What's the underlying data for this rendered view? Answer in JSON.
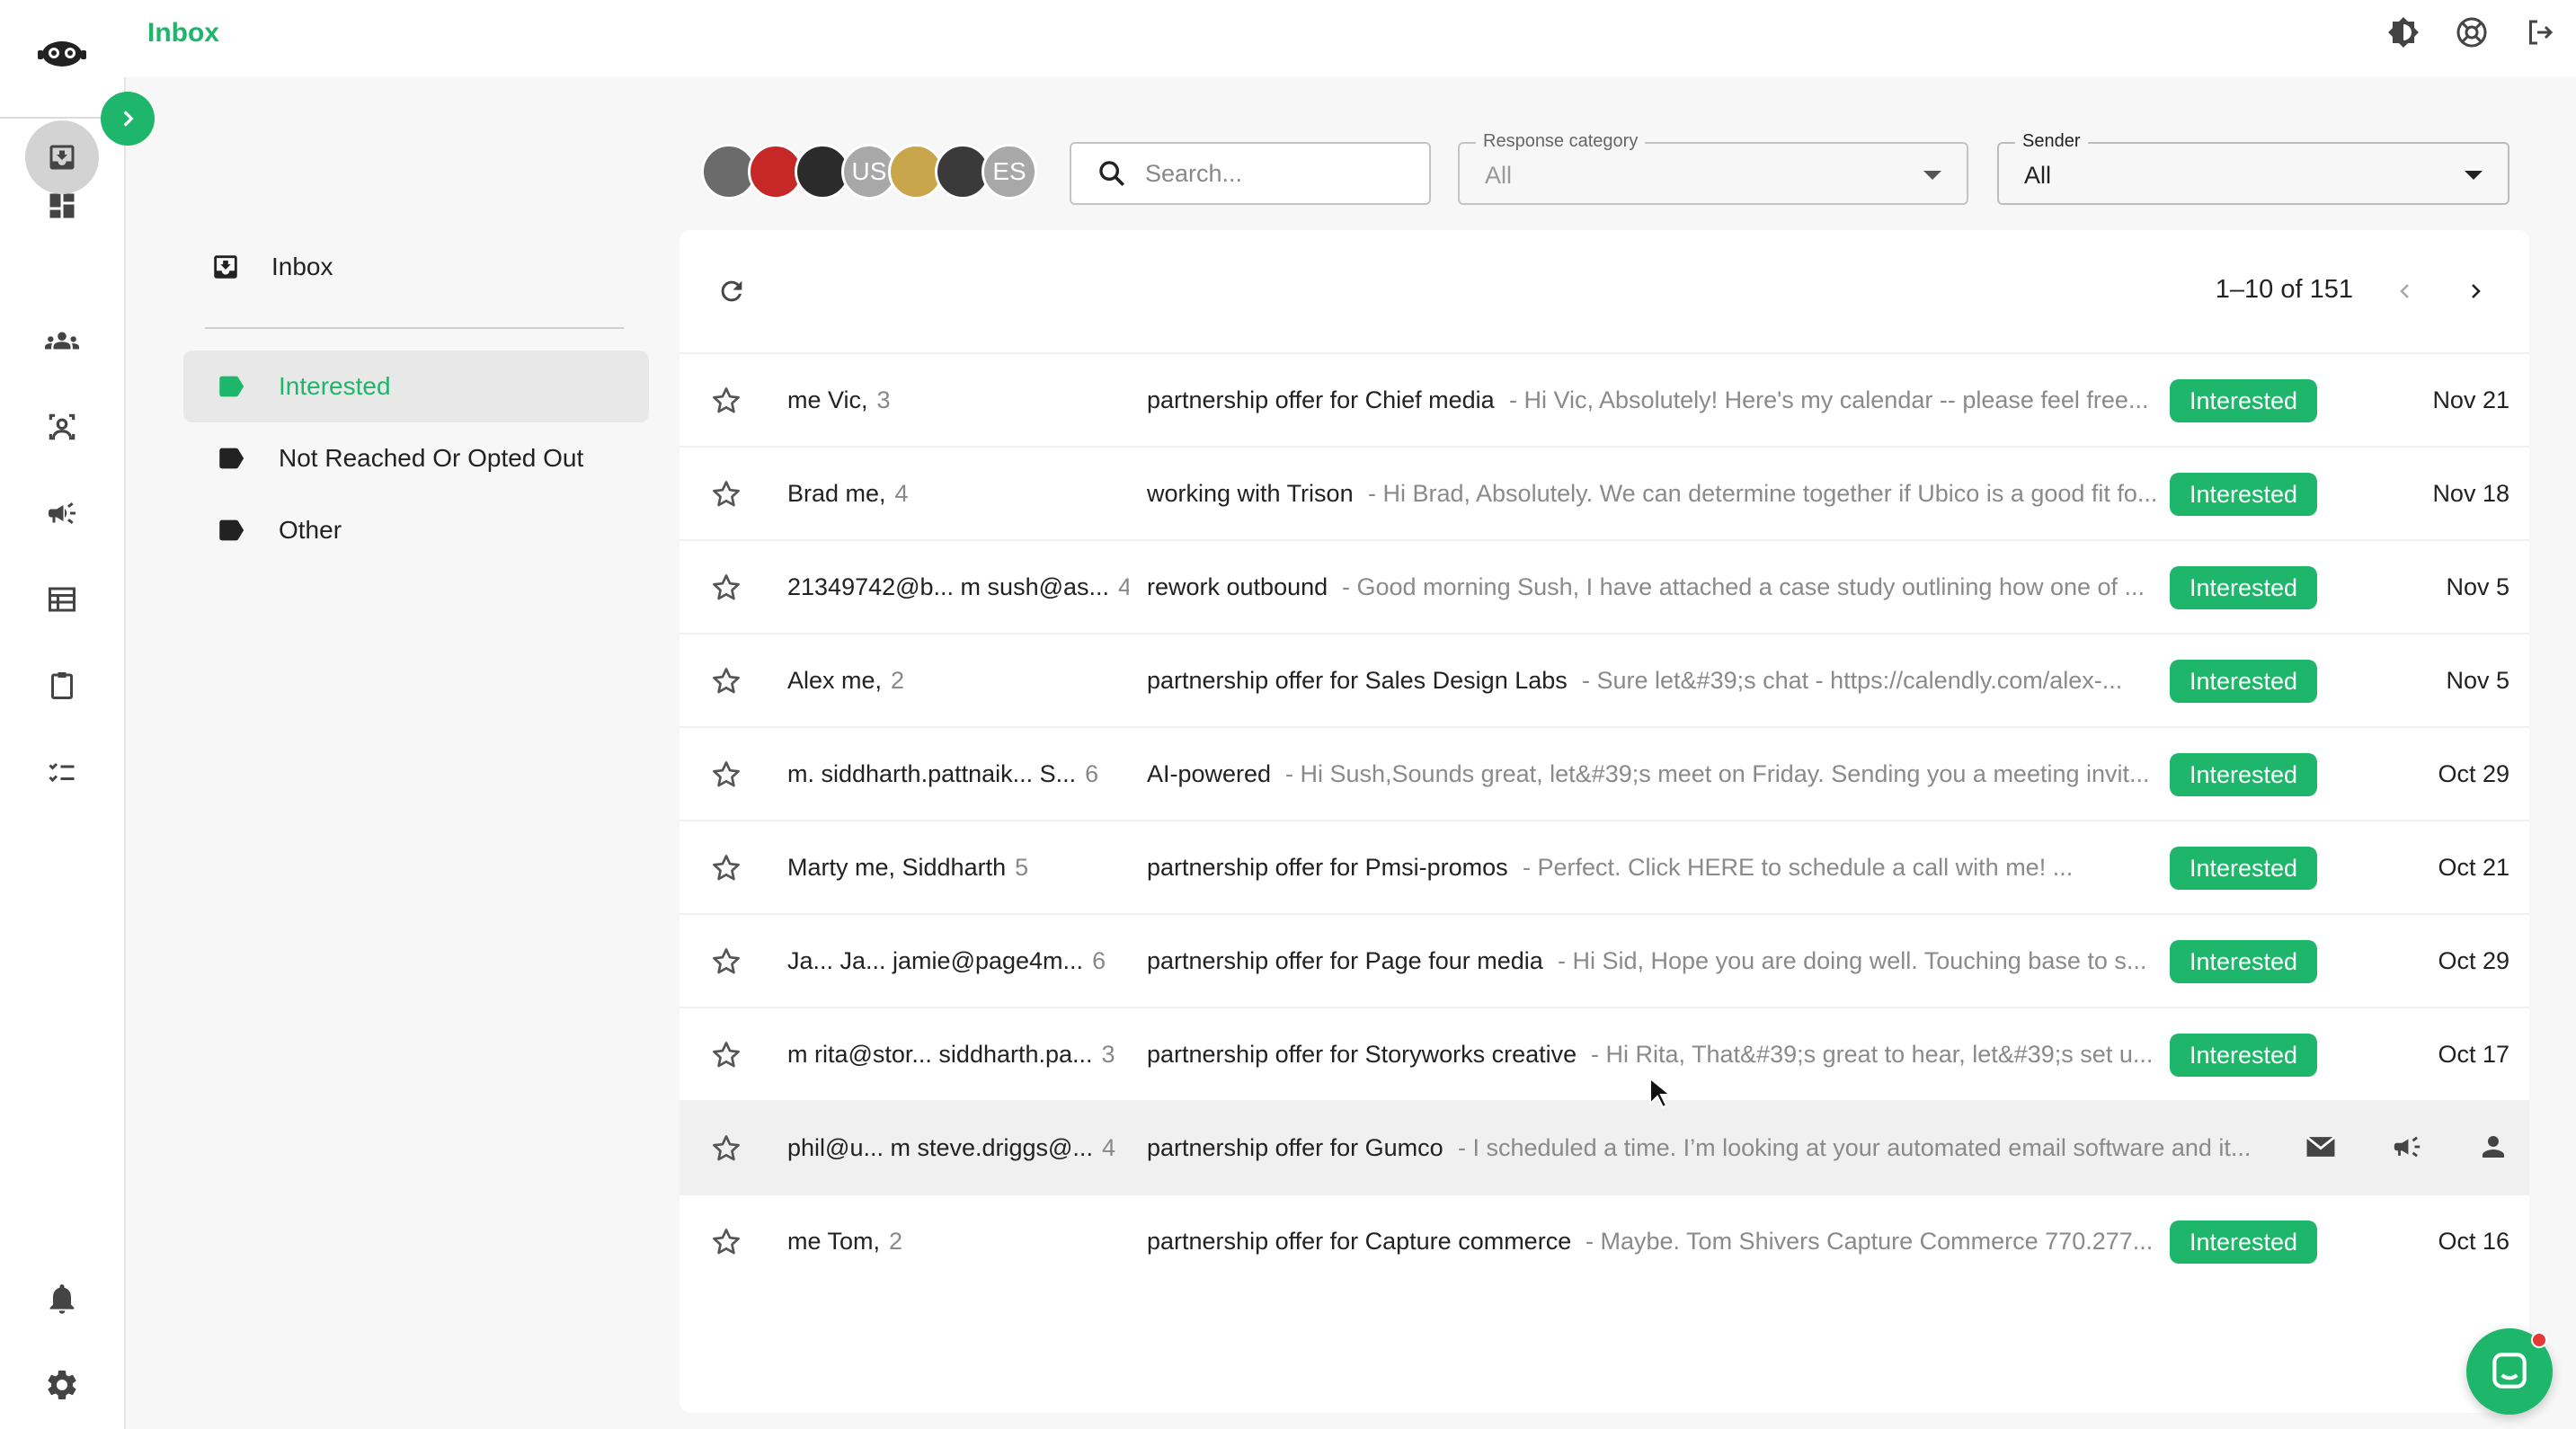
{
  "app": {
    "title": "Inbox",
    "brand_color": "#1db66a"
  },
  "topbar": {
    "icons": [
      "theme-toggle-icon",
      "support-icon",
      "logout-icon"
    ]
  },
  "rail": {
    "items": [
      {
        "name": "dashboard-icon"
      },
      {
        "name": "inbox-icon",
        "active": true
      },
      {
        "name": "team-icon"
      },
      {
        "name": "contacts-icon"
      },
      {
        "name": "campaigns-icon"
      },
      {
        "name": "table-icon"
      },
      {
        "name": "clipboard-icon"
      },
      {
        "name": "tasks-icon"
      }
    ],
    "bottom": [
      "bell-icon",
      "settings-icon"
    ]
  },
  "folders": {
    "inbox_label": "Inbox",
    "items": [
      {
        "label": "Interested",
        "active": true
      },
      {
        "label": "Not Reached Or Opted Out",
        "active": false
      },
      {
        "label": "Other",
        "active": false
      }
    ]
  },
  "filters": {
    "avatars": [
      {
        "initials": "",
        "color": "#6b6b6b"
      },
      {
        "initials": "",
        "color": "#c62828"
      },
      {
        "initials": "",
        "color": "#2b2b2b"
      },
      {
        "initials": "US",
        "color": "#9e9e9e"
      },
      {
        "initials": "",
        "color": "#c9a54c"
      },
      {
        "initials": "",
        "color": "#3a3a3a"
      },
      {
        "initials": "ES",
        "color": "#9e9e9e"
      }
    ],
    "search_placeholder": "Search...",
    "response_category_label": "Response category",
    "response_category_value": "All",
    "sender_label": "Sender",
    "sender_value": "All"
  },
  "list": {
    "pager": "1–10 of 151",
    "rows": [
      {
        "sender": "me Vic,",
        "count": "3",
        "subject": "partnership offer for Chief media",
        "snippet": "Hi Vic, Absolutely! Here's my calendar -- please feel free...",
        "badge": "Interested",
        "date": "Nov 21"
      },
      {
        "sender": "Brad me,",
        "count": "4",
        "subject": "working with Trison",
        "snippet": "Hi Brad, Absolutely. We can determine together if Ubico is a good fit fo...",
        "badge": "Interested",
        "date": "Nov 18"
      },
      {
        "sender": "21349742@b...   m sush@as...",
        "count": "4",
        "subject": "rework outbound",
        "snippet": "Good morning Sush, I have attached a case study outlining how one of ...",
        "badge": "Interested",
        "date": "Nov 5"
      },
      {
        "sender": "Alex me,",
        "count": "2",
        "subject": "partnership offer for Sales Design Labs",
        "snippet": "Sure let&#39;s chat - https://calendly.com/alex-...",
        "badge": "Interested",
        "date": "Nov 5"
      },
      {
        "sender": "m. siddharth.pattnaik...   S...",
        "count": "6",
        "subject": "AI-powered",
        "snippet": "Hi Sush,Sounds great, let&#39;s meet on Friday. Sending you a meeting invit...",
        "badge": "Interested",
        "date": "Oct 29"
      },
      {
        "sender": "Marty me, Siddharth",
        "count": "5",
        "subject": "partnership offer for Pmsi-promos",
        "snippet": "Perfect.   Click HERE to schedule a call with me!            ...",
        "badge": "Interested",
        "date": "Oct 21"
      },
      {
        "sender": "Ja...   Ja...   jamie@page4m...",
        "count": "6",
        "subject": "partnership offer for Page four media",
        "snippet": "Hi Sid, Hope you are doing well. Touching base to s...",
        "badge": "Interested",
        "date": "Oct 29"
      },
      {
        "sender": "m rita@stor...   siddharth.pa...",
        "count": "3",
        "subject": "partnership offer for Storyworks creative",
        "snippet": "Hi Rita, That&#39;s great to hear, let&#39;s set u...",
        "badge": "Interested",
        "date": "Oct 17"
      },
      {
        "sender": "phil@u...   m  steve.driggs@...",
        "count": "4",
        "subject": "partnership offer for Gumco",
        "snippet": "I scheduled a time. I’m looking at your automated email software and it...",
        "badge": "",
        "date": "",
        "hover": true
      },
      {
        "sender": "me Tom,",
        "count": "2",
        "subject": "partnership offer for Capture commerce",
        "snippet": "Maybe. Tom Shivers Capture Commerce 770.277...",
        "badge": "Interested",
        "date": "Oct 16"
      }
    ]
  }
}
